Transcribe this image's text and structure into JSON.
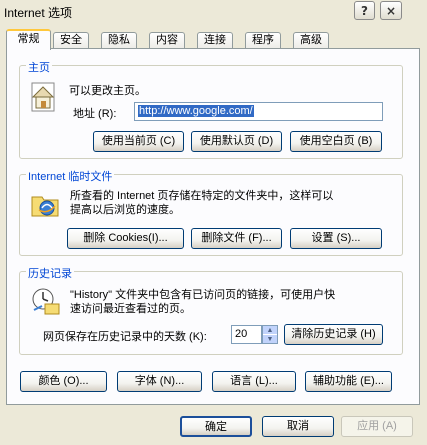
{
  "window": {
    "title": "Internet 选项",
    "help_label": "?",
    "close_label": "×"
  },
  "tabs": [
    {
      "label": "常规",
      "active": true
    },
    {
      "label": "安全"
    },
    {
      "label": "隐私"
    },
    {
      "label": "内容"
    },
    {
      "label": "连接"
    },
    {
      "label": "程序"
    },
    {
      "label": "高级"
    }
  ],
  "home": {
    "title": "主页",
    "description": "可以更改主页。",
    "address_label": "地址 (R):",
    "address_value": "http://www.google.com/",
    "buttons": [
      "使用当前页 (C)",
      "使用默认页 (D)",
      "使用空白页 (B)"
    ]
  },
  "temp_files": {
    "title": "Internet 临时文件",
    "description_line1": "所查看的 Internet 页存储在特定的文件夹中，这样可以",
    "description_line2": "提高以后浏览的速度。",
    "buttons": [
      "删除 Cookies(I)...",
      "删除文件 (F)...",
      "设置 (S)..."
    ]
  },
  "history": {
    "title": "历史记录",
    "description_line1": "\"History\" 文件夹中包含有已访问页的链接，可使用户快",
    "description_line2": "速访问最近查看过的页。",
    "days_label": "网页保存在历史记录中的天数 (K):",
    "days_value": "20",
    "clear_button": "清除历史记录 (H)"
  },
  "bottom_buttons": [
    "颜色 (O)...",
    "字体 (N)...",
    "语言 (L)...",
    "辅助功能 (E)..."
  ],
  "dialog_buttons": {
    "ok": "确定",
    "cancel": "取消",
    "apply": "应用 (A)"
  }
}
